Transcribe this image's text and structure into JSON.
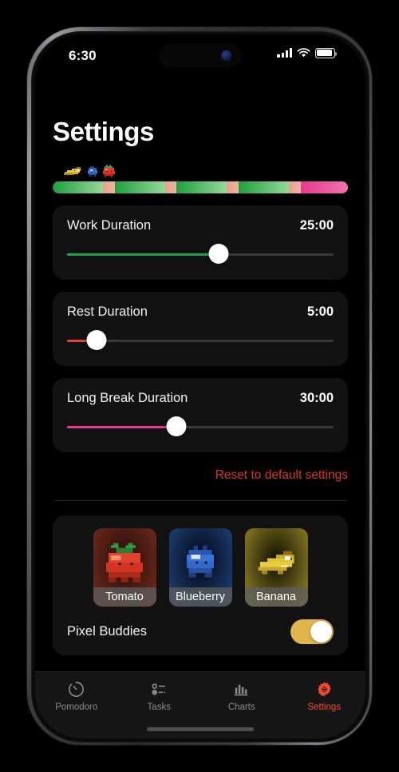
{
  "statusbar": {
    "time": "6:30",
    "signal_icon": "cellular-bars-icon",
    "wifi_icon": "wifi-icon",
    "battery_icon": "battery-icon",
    "recording_dot": "blue-indicator-dot"
  },
  "header": {
    "title": "Settings"
  },
  "session_progress": {
    "buddies": [
      {
        "name": "banana-sprite"
      },
      {
        "name": "blueberry-sprite"
      },
      {
        "name": "tomato-sprite"
      }
    ],
    "segments": [
      {
        "type": "work",
        "flex": 17
      },
      {
        "type": "rest",
        "flex": 4
      },
      {
        "type": "work",
        "flex": 17
      },
      {
        "type": "rest",
        "flex": 4
      },
      {
        "type": "work",
        "flex": 17
      },
      {
        "type": "rest",
        "flex": 4
      },
      {
        "type": "work",
        "flex": 17
      },
      {
        "type": "rest",
        "flex": 4
      },
      {
        "type": "long",
        "flex": 16
      }
    ],
    "colors": {
      "work": "#1fa03c",
      "rest": "#e8a08e",
      "long": "#e8388f"
    }
  },
  "sliders": [
    {
      "label": "Work Duration",
      "value": "25:00",
      "percent": 57,
      "color": "#1fa14a"
    },
    {
      "label": "Rest Duration",
      "value": "5:00",
      "percent": 11,
      "color": "#d9463a"
    },
    {
      "label": "Long Break Duration",
      "value": "30:00",
      "percent": 41,
      "color": "#e8388f"
    }
  ],
  "reset": {
    "label": "Reset to default settings",
    "color": "#d8371f"
  },
  "buddy_picker": {
    "options": [
      {
        "label": "Tomato",
        "icon": "tomato-sprite"
      },
      {
        "label": "Blueberry",
        "icon": "blueberry-sprite"
      },
      {
        "label": "Banana",
        "icon": "banana-sprite"
      }
    ]
  },
  "pixel_buddies_toggle": {
    "label": "Pixel Buddies",
    "state": "on",
    "color": "#e0b64c"
  },
  "tabbar": {
    "items": [
      {
        "label": "Pomodoro",
        "icon": "timer-icon",
        "active": false
      },
      {
        "label": "Tasks",
        "icon": "list-icon",
        "active": false
      },
      {
        "label": "Charts",
        "icon": "bar-chart-icon",
        "active": false
      },
      {
        "label": "Settings",
        "icon": "gear-icon",
        "active": true
      }
    ],
    "active_color": "#f4492c",
    "inactive_color": "#8a8a8e"
  }
}
